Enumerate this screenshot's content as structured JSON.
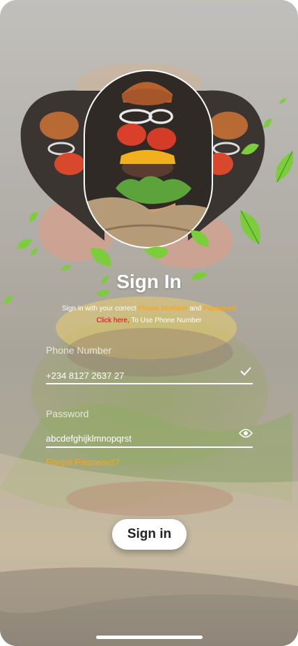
{
  "title": "Sign In",
  "subtitle": {
    "line1_pre": "Sign in with your correct ",
    "phone_highlight": "Phone Number",
    "and_text": " and ",
    "password_highlight": "Password",
    "click_here": "Click here,",
    "line2_post": " To Use Phone Number"
  },
  "phone_field": {
    "label": "Phone Number",
    "value": "+234 8127 2637 27"
  },
  "password_field": {
    "label": "Password",
    "value": "abcdefghijklmnopqrst"
  },
  "forgot_password": "Forgot Password?",
  "signin_button": "Sign in",
  "colors": {
    "accent": "#f5a623",
    "link_red": "#e0001b",
    "text": "#ffffff"
  },
  "icons": [
    "check-icon",
    "eye-icon",
    "leaf-icon"
  ]
}
